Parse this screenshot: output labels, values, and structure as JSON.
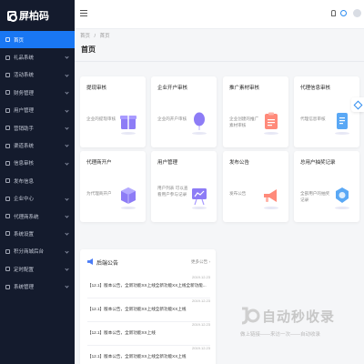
{
  "app": {
    "logo_text": "屏柏码"
  },
  "sidebar": {
    "items": [
      {
        "label": "首页",
        "active": true,
        "arrow": false
      },
      {
        "label": "礼品系统",
        "active": false,
        "arrow": true
      },
      {
        "label": "活动系统",
        "active": false,
        "arrow": true
      },
      {
        "label": "财务管理",
        "active": false,
        "arrow": true
      },
      {
        "label": "用户管理",
        "active": false,
        "arrow": true
      },
      {
        "label": "营销助手",
        "active": false,
        "arrow": true
      },
      {
        "label": "渠道系统",
        "active": false,
        "arrow": true
      },
      {
        "label": "信息审核",
        "active": false,
        "arrow": true
      },
      {
        "label": "发布信息",
        "active": false,
        "arrow": false
      },
      {
        "label": "企业中心",
        "active": false,
        "arrow": true
      },
      {
        "label": "代理商系统",
        "active": false,
        "arrow": true
      },
      {
        "label": "系统设置",
        "active": false,
        "arrow": true
      },
      {
        "label": "积分商城后台",
        "active": false,
        "arrow": true
      },
      {
        "label": "定时配置",
        "active": false,
        "arrow": true
      },
      {
        "label": "系统管理",
        "active": false,
        "arrow": true
      }
    ]
  },
  "breadcrumb": {
    "root": "首页",
    "sep": "/",
    "current": "首页"
  },
  "page": {
    "title": "首页"
  },
  "cards": [
    {
      "title": "提现审核",
      "desc": "企业的提现审核",
      "icon": "gift-icon"
    },
    {
      "title": "企业开户审核",
      "desc": "企业的开户审核",
      "icon": "balloon-icon"
    },
    {
      "title": "推广素材审核",
      "desc": "企业创建的推广素材审核",
      "icon": "clipboard-icon"
    },
    {
      "title": "代理信息审核",
      "desc": "代理信息审核",
      "icon": "ticket-icon"
    },
    {
      "title": "代理商开户",
      "desc": "为代理商开户",
      "icon": "cube-icon"
    },
    {
      "title": "用户管理",
      "desc": "用户列表 可以查看用户参与记录",
      "icon": "chart-board-icon"
    },
    {
      "title": "发布公告",
      "desc": "发布公告",
      "icon": "megaphone-icon"
    },
    {
      "title": "总用户抽奖记录",
      "desc": "全部用户的抽奖记录",
      "icon": "medal-icon"
    }
  ],
  "notice": {
    "title": "后端公告",
    "more": "更多公告 ›",
    "items": [
      {
        "date": "2019.12.23",
        "text": "【12.1】版本公告，全新功能XX上线全新功能XX上线全新功能..."
      },
      {
        "date": "2019.12.23",
        "text": "【12.1】版本公告，全新功能XX上线全新功能XX上线"
      },
      {
        "date": "2019.12.23",
        "text": "【12.1】版本公告，全新功能XX上线"
      },
      {
        "date": "2019.12.23",
        "text": "【12.1】版本公告，全新功能XX上线全新功能XX上线"
      }
    ]
  },
  "watermark": {
    "title": "自动秒收录",
    "subtitle": "做上链接——来访一次——自动收录"
  },
  "colors": {
    "accent": "#1977f3",
    "sidebar_bg": "#141b2d",
    "illustration": "#8d7cf6"
  }
}
